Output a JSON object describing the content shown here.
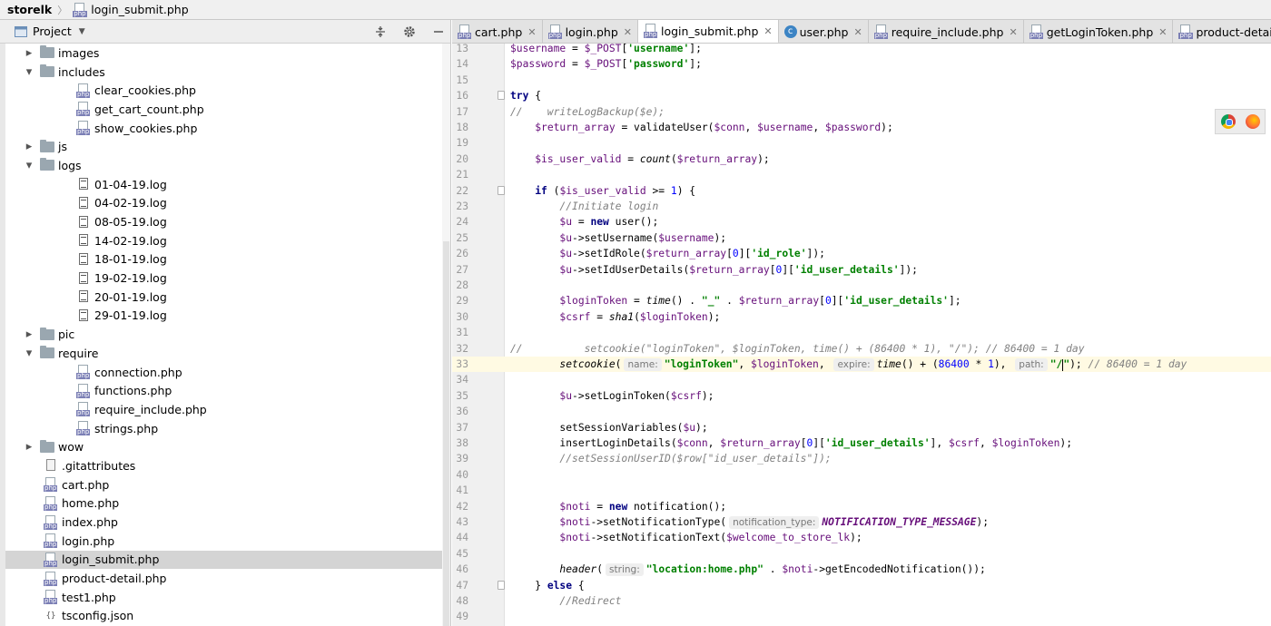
{
  "breadcrumb": {
    "project": "storelk",
    "file": "login_submit.php"
  },
  "project_panel": {
    "title": "Project"
  },
  "tree": [
    {
      "type": "folder",
      "depth": 1,
      "expanded": false,
      "label": "images"
    },
    {
      "type": "folder",
      "depth": 1,
      "expanded": true,
      "label": "includes"
    },
    {
      "type": "php",
      "depth": 2,
      "label": "clear_cookies.php"
    },
    {
      "type": "php",
      "depth": 2,
      "label": "get_cart_count.php"
    },
    {
      "type": "php",
      "depth": 2,
      "label": "show_cookies.php"
    },
    {
      "type": "folder",
      "depth": 1,
      "expanded": false,
      "label": "js"
    },
    {
      "type": "folder",
      "depth": 1,
      "expanded": true,
      "label": "logs"
    },
    {
      "type": "log",
      "depth": 2,
      "label": "01-04-19.log"
    },
    {
      "type": "log",
      "depth": 2,
      "label": "04-02-19.log"
    },
    {
      "type": "log",
      "depth": 2,
      "label": "08-05-19.log"
    },
    {
      "type": "log",
      "depth": 2,
      "label": "14-02-19.log"
    },
    {
      "type": "log",
      "depth": 2,
      "label": "18-01-19.log"
    },
    {
      "type": "log",
      "depth": 2,
      "label": "19-02-19.log"
    },
    {
      "type": "log",
      "depth": 2,
      "label": "20-01-19.log"
    },
    {
      "type": "log",
      "depth": 2,
      "label": "29-01-19.log"
    },
    {
      "type": "folder",
      "depth": 1,
      "expanded": false,
      "label": "pic"
    },
    {
      "type": "folder",
      "depth": 1,
      "expanded": true,
      "label": "require"
    },
    {
      "type": "php",
      "depth": 2,
      "label": "connection.php"
    },
    {
      "type": "php",
      "depth": 2,
      "label": "functions.php"
    },
    {
      "type": "php",
      "depth": 2,
      "label": "require_include.php"
    },
    {
      "type": "php",
      "depth": 2,
      "label": "strings.php"
    },
    {
      "type": "folder",
      "depth": 1,
      "expanded": false,
      "label": "wow"
    },
    {
      "type": "file",
      "depth": 1,
      "label": ".gitattributes"
    },
    {
      "type": "php",
      "depth": 1,
      "label": "cart.php"
    },
    {
      "type": "php",
      "depth": 1,
      "label": "home.php"
    },
    {
      "type": "php",
      "depth": 1,
      "label": "index.php"
    },
    {
      "type": "php",
      "depth": 1,
      "label": "login.php"
    },
    {
      "type": "php",
      "depth": 1,
      "label": "login_submit.php",
      "selected": true
    },
    {
      "type": "php",
      "depth": 1,
      "label": "product-detail.php"
    },
    {
      "type": "php",
      "depth": 1,
      "label": "test1.php"
    },
    {
      "type": "json",
      "depth": 1,
      "label": "tsconfig.json"
    }
  ],
  "tabs": [
    {
      "label": "cart.php",
      "icon": "php"
    },
    {
      "label": "login.php",
      "icon": "php"
    },
    {
      "label": "login_submit.php",
      "icon": "php",
      "active": true
    },
    {
      "label": "user.php",
      "icon": "class"
    },
    {
      "label": "require_include.php",
      "icon": "php"
    },
    {
      "label": "getLoginToken.php",
      "icon": "php"
    },
    {
      "label": "product-detail.php",
      "icon": "php"
    }
  ],
  "icons": {
    "php_tag": "php",
    "class_tag": "c",
    "json_tag": "{}"
  },
  "code_lines": [
    {
      "n": "13",
      "tokens": [
        [
          "v",
          "$username"
        ],
        [
          "p",
          " = "
        ],
        [
          "v",
          "$_POST"
        ],
        [
          "p",
          "["
        ],
        [
          "str",
          "'username'"
        ],
        [
          "p",
          "];"
        ]
      ]
    },
    {
      "n": "14",
      "tokens": [
        [
          "v",
          "$password"
        ],
        [
          "p",
          " = "
        ],
        [
          "v",
          "$_POST"
        ],
        [
          "p",
          "["
        ],
        [
          "str",
          "'password'"
        ],
        [
          "p",
          "];"
        ]
      ]
    },
    {
      "n": "15",
      "tokens": []
    },
    {
      "n": "16",
      "fold": true,
      "tokens": [
        [
          "kw",
          "try"
        ],
        [
          "p",
          " {"
        ]
      ]
    },
    {
      "n": "17",
      "tokens": [
        [
          "cm",
          "//    writeLogBackup($e);"
        ]
      ]
    },
    {
      "n": "18",
      "tokens": [
        [
          "p",
          "    "
        ],
        [
          "v",
          "$return_array"
        ],
        [
          "p",
          " = validateUser("
        ],
        [
          "v",
          "$conn"
        ],
        [
          "p",
          ", "
        ],
        [
          "v",
          "$username"
        ],
        [
          "p",
          ", "
        ],
        [
          "v",
          "$password"
        ],
        [
          "p",
          ");"
        ]
      ]
    },
    {
      "n": "19",
      "tokens": []
    },
    {
      "n": "20",
      "tokens": [
        [
          "p",
          "    "
        ],
        [
          "v",
          "$is_user_valid"
        ],
        [
          "p",
          " = "
        ],
        [
          "fnI",
          "count"
        ],
        [
          "p",
          "("
        ],
        [
          "v",
          "$return_array"
        ],
        [
          "p",
          ");"
        ]
      ]
    },
    {
      "n": "21",
      "tokens": []
    },
    {
      "n": "22",
      "fold": true,
      "tokens": [
        [
          "p",
          "    "
        ],
        [
          "kw",
          "if"
        ],
        [
          "p",
          " ("
        ],
        [
          "v",
          "$is_user_valid"
        ],
        [
          "p",
          " >= "
        ],
        [
          "num",
          "1"
        ],
        [
          "p",
          ") {"
        ]
      ]
    },
    {
      "n": "23",
      "tokens": [
        [
          "p",
          "        "
        ],
        [
          "cm",
          "//Initiate login"
        ]
      ]
    },
    {
      "n": "24",
      "tokens": [
        [
          "p",
          "        "
        ],
        [
          "v",
          "$u"
        ],
        [
          "p",
          " = "
        ],
        [
          "kw",
          "new"
        ],
        [
          "p",
          " user();"
        ]
      ]
    },
    {
      "n": "25",
      "tokens": [
        [
          "p",
          "        "
        ],
        [
          "v",
          "$u"
        ],
        [
          "p",
          "->setUsername("
        ],
        [
          "v",
          "$username"
        ],
        [
          "p",
          ");"
        ]
      ]
    },
    {
      "n": "26",
      "tokens": [
        [
          "p",
          "        "
        ],
        [
          "v",
          "$u"
        ],
        [
          "p",
          "->setIdRole("
        ],
        [
          "v",
          "$return_array"
        ],
        [
          "p",
          "["
        ],
        [
          "num",
          "0"
        ],
        [
          "p",
          "]["
        ],
        [
          "str",
          "'id_role'"
        ],
        [
          "p",
          "]);"
        ]
      ]
    },
    {
      "n": "27",
      "tokens": [
        [
          "p",
          "        "
        ],
        [
          "v",
          "$u"
        ],
        [
          "p",
          "->setIdUserDetails("
        ],
        [
          "v",
          "$return_array"
        ],
        [
          "p",
          "["
        ],
        [
          "num",
          "0"
        ],
        [
          "p",
          "]["
        ],
        [
          "str",
          "'id_user_details'"
        ],
        [
          "p",
          "]);"
        ]
      ]
    },
    {
      "n": "28",
      "tokens": []
    },
    {
      "n": "29",
      "tokens": [
        [
          "p",
          "        "
        ],
        [
          "v",
          "$loginToken"
        ],
        [
          "p",
          " = "
        ],
        [
          "fnI",
          "time"
        ],
        [
          "p",
          "() . "
        ],
        [
          "str",
          "\"_\""
        ],
        [
          "p",
          " . "
        ],
        [
          "v",
          "$return_array"
        ],
        [
          "p",
          "["
        ],
        [
          "num",
          "0"
        ],
        [
          "p",
          "]["
        ],
        [
          "str",
          "'id_user_details'"
        ],
        [
          "p",
          "];"
        ]
      ]
    },
    {
      "n": "30",
      "tokens": [
        [
          "p",
          "        "
        ],
        [
          "v",
          "$csrf"
        ],
        [
          "p",
          " = "
        ],
        [
          "fnI",
          "sha1"
        ],
        [
          "p",
          "("
        ],
        [
          "v",
          "$loginToken"
        ],
        [
          "p",
          ");"
        ]
      ]
    },
    {
      "n": "31",
      "tokens": []
    },
    {
      "n": "32",
      "tokens": [
        [
          "cm",
          "//          setcookie(\"loginToken\", $loginToken, time() + (86400 * 1), \"/\"); // 86400 = 1 day"
        ]
      ]
    },
    {
      "n": "33",
      "current": true,
      "tokens": [
        [
          "p",
          "        "
        ],
        [
          "fnI",
          "setcookie"
        ],
        [
          "p",
          "("
        ],
        [
          "hint",
          "name:"
        ],
        [
          "str",
          "\"loginToken\""
        ],
        [
          "p",
          ", "
        ],
        [
          "v",
          "$loginToken"
        ],
        [
          "p",
          ", "
        ],
        [
          "hint",
          "expire:"
        ],
        [
          "fnI",
          "time"
        ],
        [
          "p",
          "() + ("
        ],
        [
          "num",
          "86400"
        ],
        [
          "p",
          " * "
        ],
        [
          "num",
          "1"
        ],
        [
          "p",
          "), "
        ],
        [
          "hint",
          "path:"
        ],
        [
          "str",
          "\"/"
        ],
        [
          "caret",
          ""
        ],
        [
          "str",
          "\""
        ],
        [
          "p",
          "); "
        ],
        [
          "cm",
          "// 86400 = 1 day"
        ]
      ]
    },
    {
      "n": "34",
      "tokens": []
    },
    {
      "n": "35",
      "tokens": [
        [
          "p",
          "        "
        ],
        [
          "v",
          "$u"
        ],
        [
          "p",
          "->setLoginToken("
        ],
        [
          "v",
          "$csrf"
        ],
        [
          "p",
          ");"
        ]
      ]
    },
    {
      "n": "36",
      "tokens": []
    },
    {
      "n": "37",
      "tokens": [
        [
          "p",
          "        setSessionVariables("
        ],
        [
          "v",
          "$u"
        ],
        [
          "p",
          ");"
        ]
      ]
    },
    {
      "n": "38",
      "tokens": [
        [
          "p",
          "        insertLoginDetails("
        ],
        [
          "v",
          "$conn"
        ],
        [
          "p",
          ", "
        ],
        [
          "v",
          "$return_array"
        ],
        [
          "p",
          "["
        ],
        [
          "num",
          "0"
        ],
        [
          "p",
          "]["
        ],
        [
          "str",
          "'id_user_details'"
        ],
        [
          "p",
          "], "
        ],
        [
          "v",
          "$csrf"
        ],
        [
          "p",
          ", "
        ],
        [
          "v",
          "$loginToken"
        ],
        [
          "p",
          ");"
        ]
      ]
    },
    {
      "n": "39",
      "tokens": [
        [
          "p",
          "        "
        ],
        [
          "cm",
          "//setSessionUserID($row[\"id_user_details\"]);"
        ]
      ]
    },
    {
      "n": "40",
      "tokens": []
    },
    {
      "n": "41",
      "tokens": []
    },
    {
      "n": "42",
      "tokens": [
        [
          "p",
          "        "
        ],
        [
          "v",
          "$noti"
        ],
        [
          "p",
          " = "
        ],
        [
          "kw",
          "new"
        ],
        [
          "p",
          " notification();"
        ]
      ]
    },
    {
      "n": "43",
      "tokens": [
        [
          "p",
          "        "
        ],
        [
          "v",
          "$noti"
        ],
        [
          "p",
          "->setNotificationType("
        ],
        [
          "hint",
          "notification_type:"
        ],
        [
          "cst",
          "NOTIFICATION_TYPE_MESSAGE"
        ],
        [
          "p",
          ");"
        ]
      ]
    },
    {
      "n": "44",
      "tokens": [
        [
          "p",
          "        "
        ],
        [
          "v",
          "$noti"
        ],
        [
          "p",
          "->setNotificationText("
        ],
        [
          "v",
          "$welcome_to_store_lk"
        ],
        [
          "p",
          ");"
        ]
      ]
    },
    {
      "n": "45",
      "tokens": []
    },
    {
      "n": "46",
      "tokens": [
        [
          "p",
          "        "
        ],
        [
          "fnI",
          "header"
        ],
        [
          "p",
          "("
        ],
        [
          "hint",
          "string:"
        ],
        [
          "str",
          "\"location:home.php\""
        ],
        [
          "p",
          " . "
        ],
        [
          "v",
          "$noti"
        ],
        [
          "p",
          "->getEncodedNotification());"
        ]
      ]
    },
    {
      "n": "47",
      "fold": true,
      "tokens": [
        [
          "p",
          "    } "
        ],
        [
          "kw",
          "else"
        ],
        [
          "p",
          " {"
        ]
      ]
    },
    {
      "n": "48",
      "tokens": [
        [
          "p",
          "        "
        ],
        [
          "cm",
          "//Redirect"
        ]
      ]
    },
    {
      "n": "49",
      "tokens": []
    }
  ]
}
